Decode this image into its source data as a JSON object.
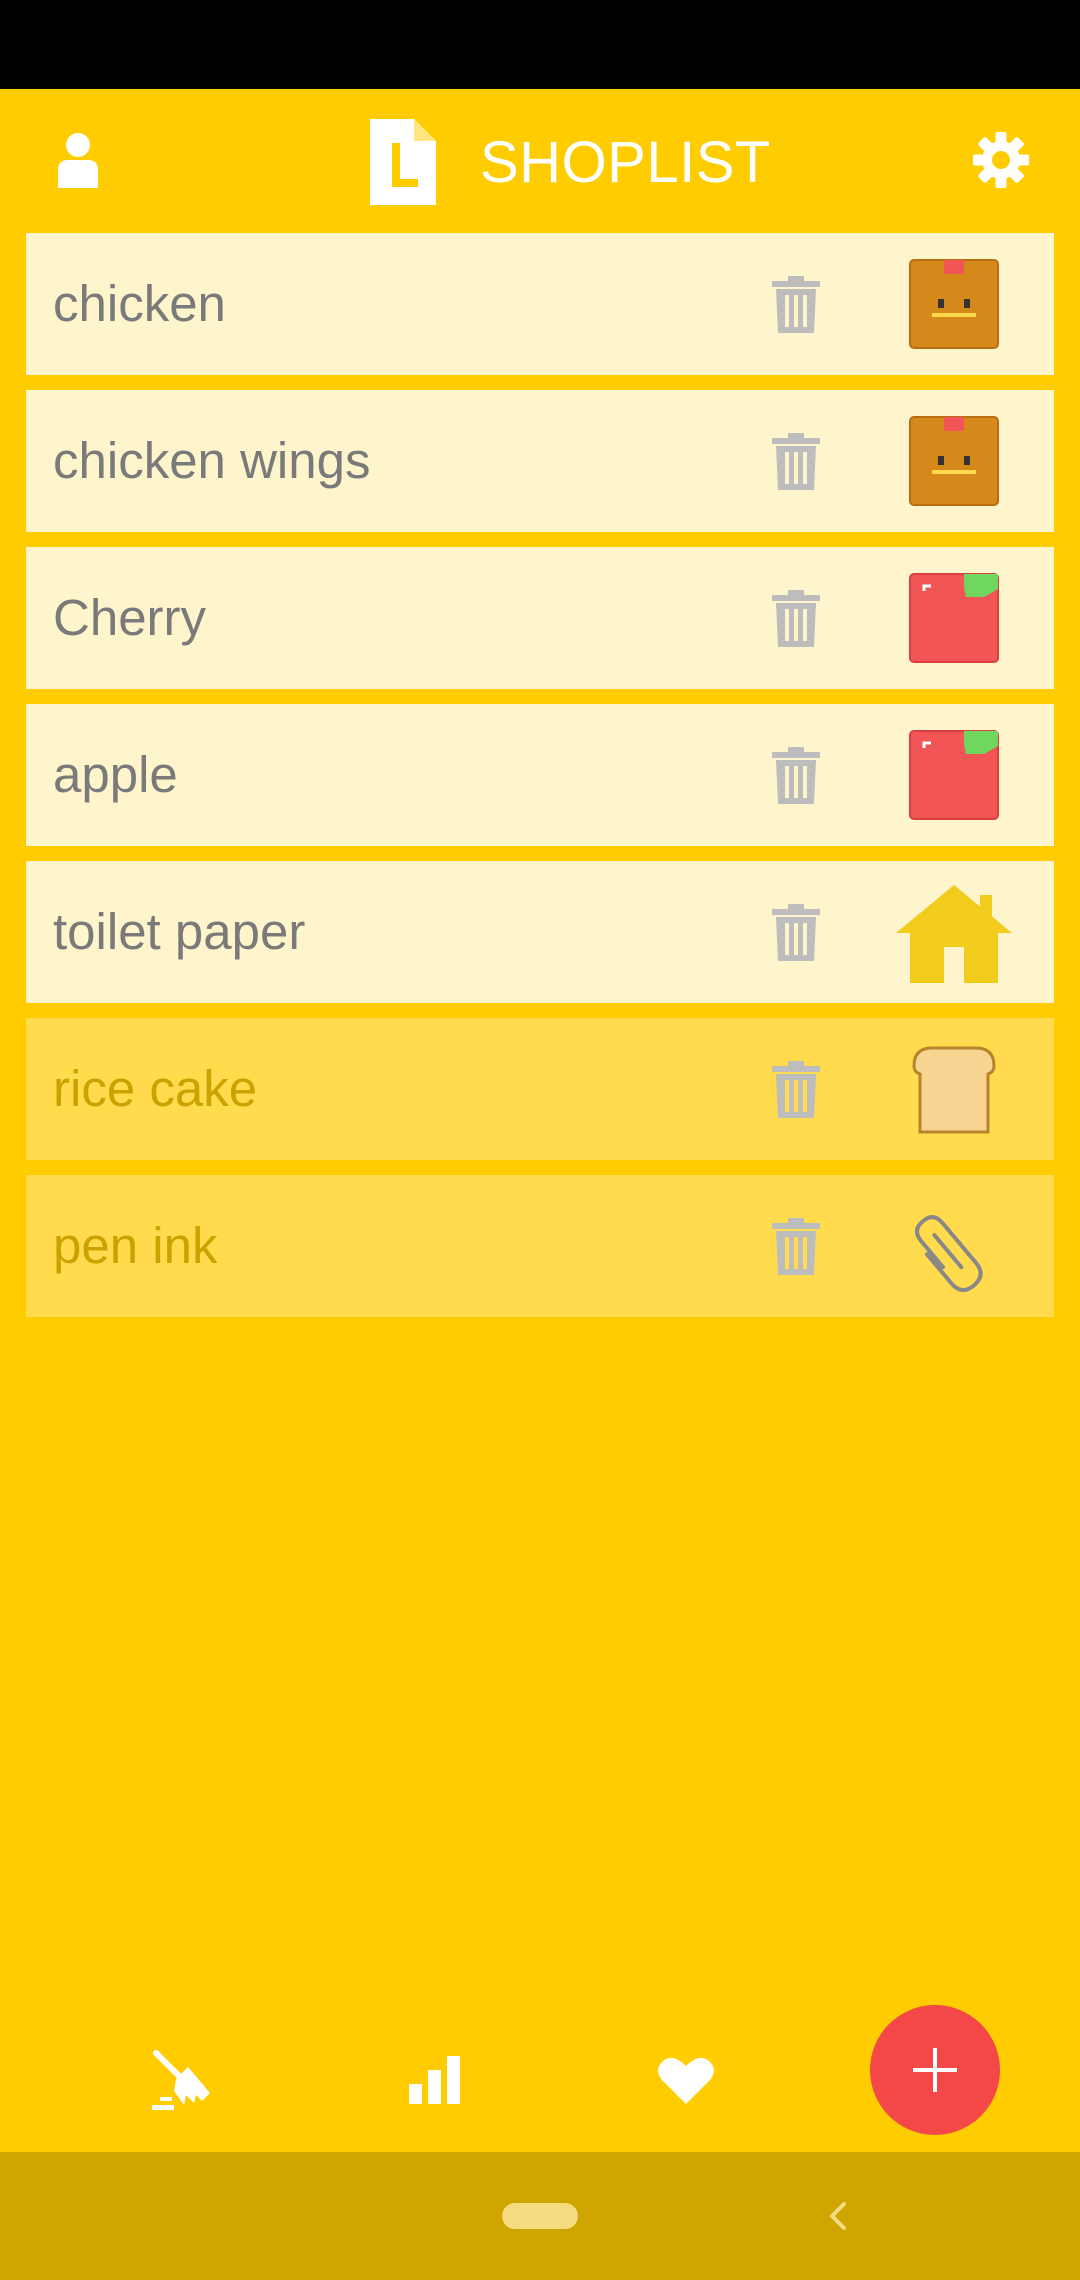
{
  "header": {
    "title": "SHOPLIST"
  },
  "items": [
    {
      "name": "chicken",
      "category": "meat",
      "done": false
    },
    {
      "name": "chicken wings",
      "category": "meat",
      "done": false
    },
    {
      "name": "Cherry",
      "category": "fruit",
      "done": false
    },
    {
      "name": "apple",
      "category": "fruit",
      "done": false
    },
    {
      "name": "toilet paper",
      "category": "household",
      "done": false
    },
    {
      "name": "rice cake",
      "category": "bakery",
      "done": true
    },
    {
      "name": "pen ink",
      "category": "office",
      "done": true
    }
  ],
  "colors": {
    "background": "#FFCC00",
    "item_active": "#FFF5CC",
    "item_done": "#FFDB4D",
    "fab": "#F44848",
    "system_nav": "#CFA500"
  },
  "icons": {
    "profile": "person-icon",
    "logo": "list-logo-icon",
    "settings": "gear-icon",
    "delete": "trash-icon",
    "clear": "broom-icon",
    "stats": "bar-chart-icon",
    "favorites": "heart-icon",
    "add": "plus-icon"
  }
}
